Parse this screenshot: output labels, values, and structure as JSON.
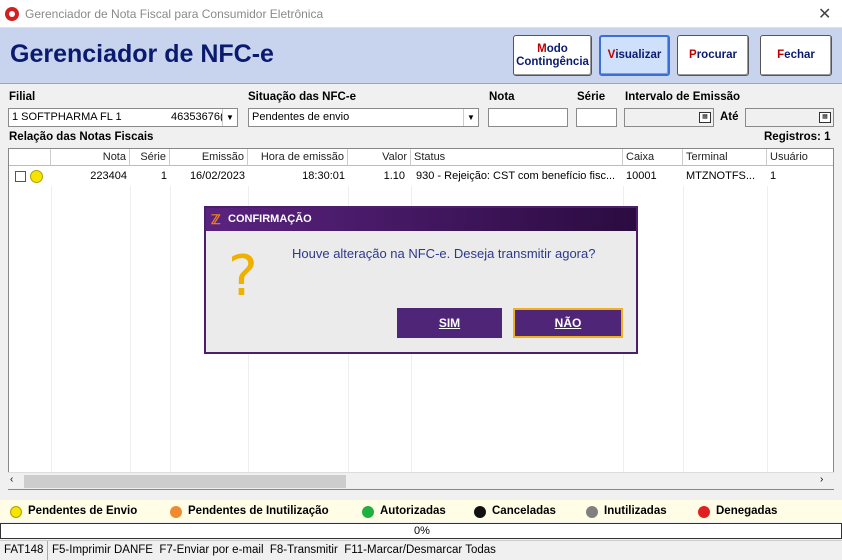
{
  "window": {
    "title": "Gerenciador de Nota Fiscal para Consumidor Eletrônica",
    "close_glyph": "✕"
  },
  "header": {
    "title": "Gerenciador de NFC-e",
    "buttons": {
      "modo_k": "M",
      "modo_rest": "odo",
      "modo_line2": "Contingência",
      "visualizar_k": "V",
      "visualizar_rest": "isualizar",
      "procurar_k": "P",
      "procurar_rest": "rocurar",
      "fechar_k": "F",
      "fechar_rest": "echar"
    }
  },
  "filters": {
    "filial_label": "Filial",
    "filial_value": "1  SOFTPHARMA FL 1",
    "filial_cnpj": "46353676(",
    "situacao_label": "Situação das NFC-e",
    "situacao_value": "Pendentes de envio",
    "nota_label": "Nota",
    "nota_value": "",
    "serie_label": "Série",
    "serie_value": "",
    "intervalo_label": "Intervalo de Emissão",
    "ate_label": "Até"
  },
  "list": {
    "title": "Relação das Notas Fiscais",
    "registros": "Registros: 1",
    "columns": [
      "Nota",
      "Série",
      "Emissão",
      "Hora de emissão",
      "Valor",
      "Status",
      "Caixa",
      "Terminal",
      "Usuário"
    ],
    "rows": [
      {
        "nota": "223404",
        "serie": "1",
        "emissao": "16/02/2023",
        "hora": "18:30:01",
        "valor": "1.10",
        "status": "930 - Rejeição: CST com benefício fisc...",
        "caixa": "10001",
        "terminal": "MTZNOTFS...",
        "usuario": "1"
      }
    ]
  },
  "legend": [
    {
      "label": "Pendentes de Envio",
      "color": "#f5e400"
    },
    {
      "label": "Pendentes de Inutilização",
      "color": "#f08a30"
    },
    {
      "label": "Autorizadas",
      "color": "#20b040"
    },
    {
      "label": "Canceladas",
      "color": "#111111"
    },
    {
      "label": "Inutilizadas",
      "color": "#808080"
    },
    {
      "label": "Denegadas",
      "color": "#e02020"
    }
  ],
  "progress": {
    "text": "0%",
    "value": 0
  },
  "statusbar": {
    "code": "FAT148",
    "shortcuts": "F5-Imprimir DANFE  F7-Enviar por e-mail  F8-Transmitir  F11-Marcar/Desmarcar Todas"
  },
  "dialog": {
    "title": "CONFIRMAÇÃO",
    "icon": "?",
    "message": "Houve alteração na NFC-e. Deseja transmitir agora?",
    "yes_label": "SIM",
    "no_label": "NÃO"
  },
  "colors": {
    "header_bg": "#c8d3ee",
    "dialog_purple": "#4e2577",
    "title_navy": "#0a1a6e"
  }
}
